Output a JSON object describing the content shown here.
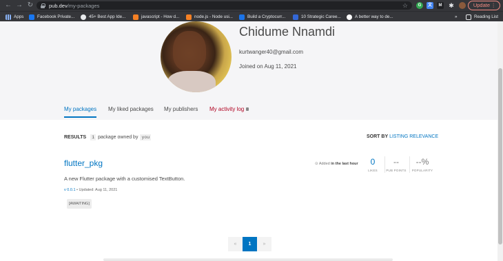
{
  "browser": {
    "url_host": "pub.dev",
    "url_path": "/my-packages",
    "update_label": "Update",
    "update_menu": "⋮",
    "bookmarks": [
      {
        "label": "Apps",
        "color": "#8ab4f8"
      },
      {
        "label": "Facebook Private...",
        "color": "#1877f2"
      },
      {
        "label": "45+ Best App Ide...",
        "color": "#e8eaed"
      },
      {
        "label": "javascript - How d...",
        "color": "#f48024"
      },
      {
        "label": "node.js - Node usi...",
        "color": "#f48024"
      },
      {
        "label": "Build a Cryptocurr...",
        "color": "#1a73e8"
      },
      {
        "label": "10 Strategic Caree...",
        "color": "#3367d6"
      },
      {
        "label": "A better way to de...",
        "color": "#ffffff"
      }
    ],
    "bookmarks_overflow": "»",
    "reading_list": "Reading List"
  },
  "profile": {
    "name": "Chidume Nnamdi",
    "email": "kurtwanger40@gmail.com",
    "joined": "Joined on Aug 11, 2021"
  },
  "tabs": [
    {
      "label": "My packages",
      "active": true
    },
    {
      "label": "My liked packages"
    },
    {
      "label": "My publishers"
    },
    {
      "label": "My activity log"
    }
  ],
  "results": {
    "label": "RESULTS",
    "count": "1",
    "text": "package owned by",
    "owner": "you"
  },
  "sort": {
    "label": "SORT BY",
    "value": "LISTING RELEVANCE"
  },
  "package": {
    "name": "flutter_pkg",
    "description": "A new Flutter package with a customised TextButton.",
    "version": "v 0.0.1",
    "updated": " • Updated: Aug 11, 2021",
    "tag": "[AWAITING]",
    "added_prefix": "⊙ Added ",
    "added_when": "in the last hour",
    "scores": [
      {
        "value": "0",
        "label": "LIKES"
      },
      {
        "value": "--",
        "label": "PUB POINTS"
      },
      {
        "value": "--%",
        "label": "POPULARITY"
      }
    ]
  },
  "pagination": {
    "prev": "«",
    "current": "1",
    "next": "»"
  },
  "colors": {
    "accent": "#0175c2",
    "danger": "#b00020",
    "chrome": "#35363a"
  }
}
